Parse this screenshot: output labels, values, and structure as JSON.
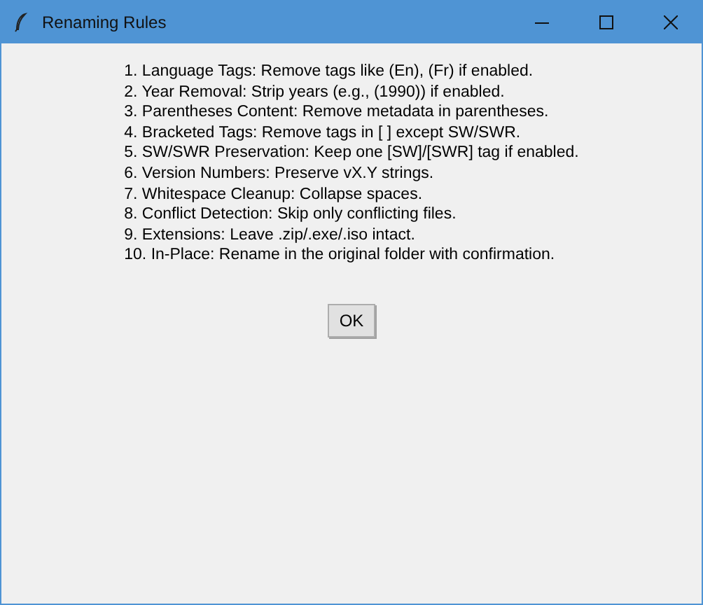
{
  "window": {
    "title": "Renaming Rules"
  },
  "rules": [
    "1. Language Tags: Remove tags like (En), (Fr) if enabled.",
    "2. Year Removal: Strip years (e.g., (1990)) if enabled.",
    "3. Parentheses Content: Remove metadata in parentheses.",
    "4. Bracketed Tags: Remove tags in [ ] except SW/SWR.",
    "5. SW/SWR Preservation: Keep one [SW]/[SWR] tag if enabled.",
    "6. Version Numbers: Preserve vX.Y strings.",
    "7. Whitespace Cleanup: Collapse spaces.",
    "8. Conflict Detection: Skip only conflicting files.",
    "9. Extensions: Leave .zip/.exe/.iso intact.",
    "10. In-Place: Rename in the original folder with confirmation."
  ],
  "buttons": [
    "OK"
  ]
}
